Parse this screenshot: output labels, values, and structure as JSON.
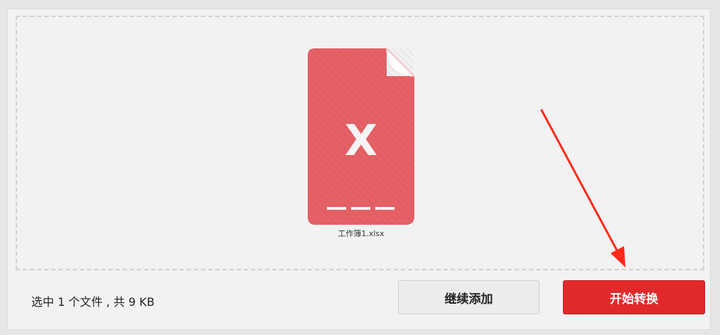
{
  "file": {
    "name": "工作簿1.xlsx",
    "icon": "excel-file-icon",
    "icon_letter": "X",
    "icon_color": "#e56166"
  },
  "footer": {
    "summary": "选中 1 个文件 , 共 9 KB",
    "add_more_label": "继续添加",
    "start_label": "开始转换"
  },
  "colors": {
    "accent": "#e1292b",
    "annotation_arrow": "#ff2a1a"
  }
}
